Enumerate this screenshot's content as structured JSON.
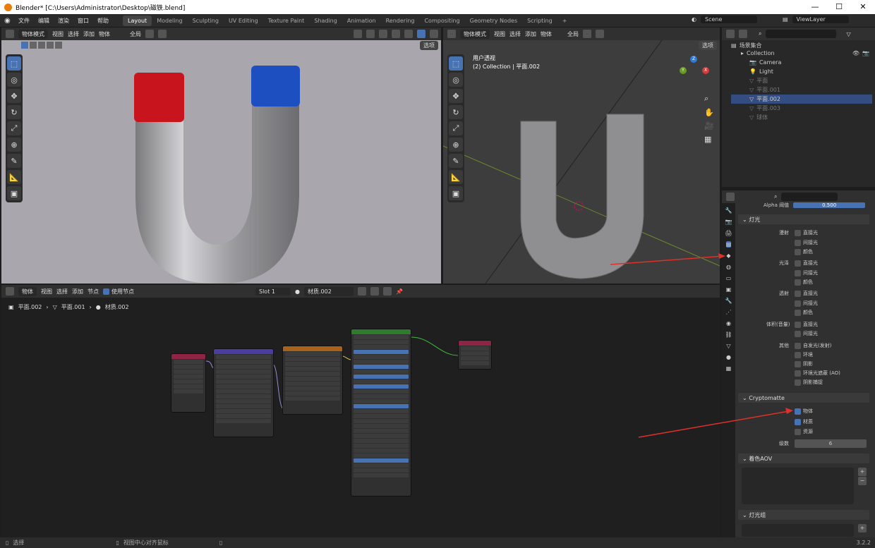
{
  "window": {
    "title": "Blender* [C:\\Users\\Administrator\\Desktop\\磁铁.blend]",
    "min": "—",
    "max": "☐",
    "close": "✕"
  },
  "menu": {
    "items": [
      "文件",
      "编辑",
      "渲染",
      "窗口",
      "帮助"
    ],
    "workspaces": [
      "Layout",
      "Modeling",
      "Sculpting",
      "UV Editing",
      "Texture Paint",
      "Shading",
      "Animation",
      "Rendering",
      "Compositing",
      "Geometry Nodes",
      "Scripting"
    ],
    "add": "+",
    "scene_label": "Scene",
    "viewlayer_label": "ViewLayer"
  },
  "vp_left": {
    "mode": "物体模式",
    "menus": [
      "视图",
      "选择",
      "添加",
      "物体"
    ],
    "orient": "全局",
    "options": "选项"
  },
  "vp_right": {
    "mode": "物体模式",
    "menus": [
      "视图",
      "选择",
      "添加",
      "物体"
    ],
    "orient": "全局",
    "options": "选项",
    "overlay_title": "用户透视",
    "overlay_sub": "(2) Collection | 平面.002",
    "gizmo": {
      "x": "X",
      "y": "Y",
      "z": "Z"
    }
  },
  "outliner": {
    "root": "场景集合",
    "rows": [
      {
        "name": "Collection",
        "dim": false
      },
      {
        "name": "Camera",
        "dim": false
      },
      {
        "name": "Light",
        "dim": false
      },
      {
        "name": "平面",
        "dim": true
      },
      {
        "name": "平面.001",
        "dim": true
      },
      {
        "name": "平面.002",
        "dim": false
      },
      {
        "name": "平面.003",
        "dim": true
      },
      {
        "name": "球体",
        "dim": true
      }
    ]
  },
  "props": {
    "alpha_label": "Alpha 阈值",
    "alpha_value": "0.500",
    "light_section": "灯光",
    "groups": [
      {
        "label": "漫射",
        "items": [
          "直接光",
          "间接光",
          "颜色"
        ]
      },
      {
        "label": "光泽",
        "items": [
          "直接光",
          "间接光",
          "颜色"
        ]
      },
      {
        "label": "透射",
        "items": [
          "直接光",
          "间接光",
          "颜色"
        ]
      },
      {
        "label": "体积(音量)",
        "items": [
          "直接光",
          "间接光"
        ]
      },
      {
        "label": "其他",
        "items": [
          "自发光(发射)",
          "环境",
          "阴影",
          "环境光遮蔽 (AO)",
          "阴影捕捉"
        ]
      }
    ],
    "crypto_section": "Cryptomatte",
    "crypto_items": [
      {
        "label": "物体",
        "checked": true
      },
      {
        "label": "材质",
        "checked": true
      },
      {
        "label": "资源",
        "checked": false
      }
    ],
    "levels_label": "级数",
    "levels_value": "6",
    "aov_section": "着色AOV",
    "lightgroup_section": "灯光组"
  },
  "node_editor": {
    "mode": "物体",
    "menus": [
      "视图",
      "选择",
      "添加",
      "节点"
    ],
    "use_nodes": "使用节点",
    "slot": "Slot 1",
    "material": "材质.002",
    "breadcrumb": [
      "平面.002",
      "平面.001",
      "材质.002"
    ]
  },
  "status": {
    "left": "选择",
    "mid": "视图中心对齐鼠标",
    "version": "3.2.2"
  },
  "colors": {
    "accent": "#4772b3",
    "red_pole": "#c8141c",
    "blue_pole": "#1e4fc0",
    "arrow": "#e0302a"
  }
}
